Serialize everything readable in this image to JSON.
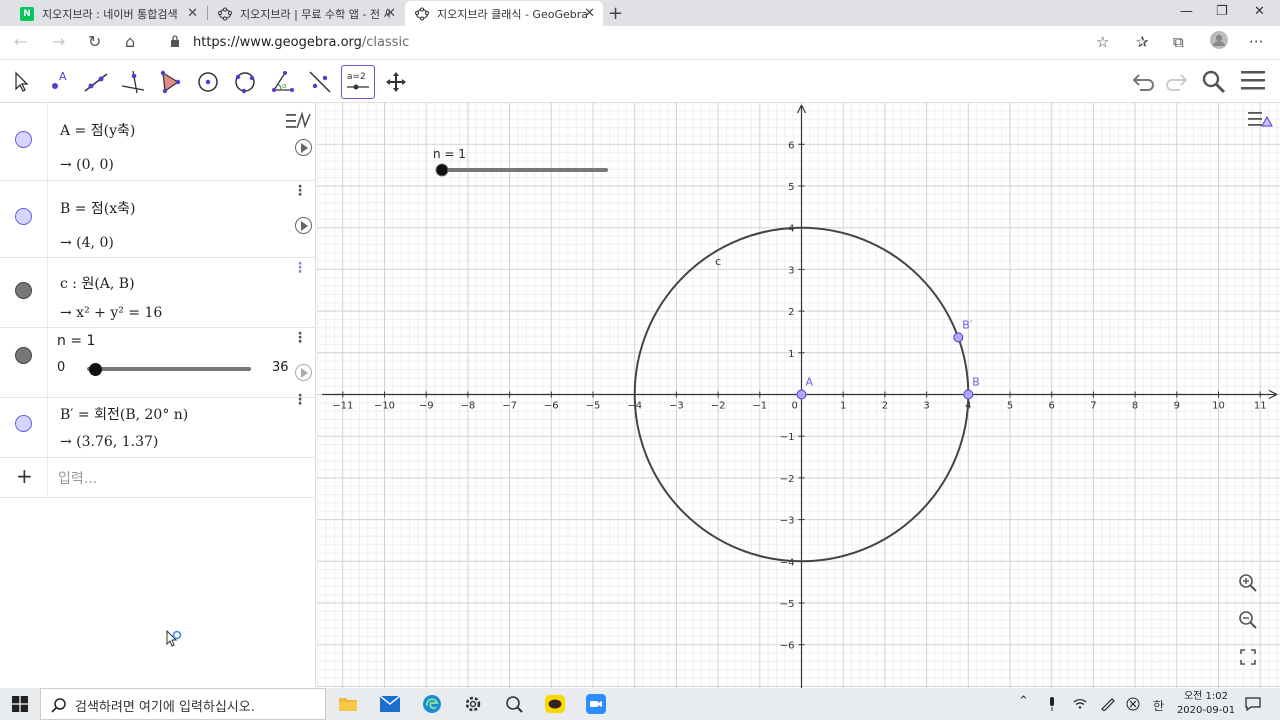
{
  "browser": {
    "tabs": [
      {
        "title": "지오지브라 : 네이버 통합검색",
        "favicon": "naver-icon",
        "active": false
      },
      {
        "title": "지오지브라 | 무료 수학 앱 - 전 세",
        "favicon": "geogebra-icon",
        "active": false
      },
      {
        "title": "지오지브라 클래식 - GeoGebra",
        "favicon": "geogebra-icon",
        "active": true
      }
    ],
    "url_host": "https://www.geogebra.org",
    "url_path": "/classic"
  },
  "toolbar": {
    "tools": [
      "move-tool",
      "point-tool",
      "line-tool",
      "perpendicular-line-tool",
      "polygon-tool",
      "circle-center-point-tool",
      "circle-three-points-tool",
      "angle-tool",
      "reflect-tool",
      "slider-tool",
      "move-graphics-tool"
    ],
    "selected_tool": "slider-tool",
    "slider_tool_label": "a=2"
  },
  "algebra": {
    "rows": [
      {
        "def": "A = 점(y축)",
        "value": "→  (0, 0)",
        "color": "#b0a8ff"
      },
      {
        "def": "B = 점(x축)",
        "value": "→  (4, 0)",
        "color": "#b0a8ff"
      },
      {
        "def": "c : 원(A, B)",
        "value": "→  x² + y² = 16",
        "color": "#616161"
      },
      {
        "def": "B′ = 회전(B, 20° n)",
        "value": "→  (3.76, 1.37)",
        "color": "#b0a8ff"
      }
    ],
    "slider": {
      "label": "n = 1",
      "min": "0",
      "max": "36",
      "value": 1
    },
    "input_placeholder": "입력..."
  },
  "graphics": {
    "slider_label": "n = 1",
    "x_ticks": [
      "−11",
      "−10",
      "−9",
      "−8",
      "−7",
      "−6",
      "−5",
      "−4",
      "−3",
      "−2",
      "−1",
      "0",
      "1",
      "2",
      "3",
      "4",
      "5",
      "6",
      "7",
      "8",
      "9",
      "10",
      "11"
    ],
    "y_ticks_pos": [
      "1",
      "2",
      "3",
      "4",
      "5",
      "6"
    ],
    "y_ticks_neg": [
      "−1",
      "−2",
      "−3",
      "−4",
      "−5",
      "−6"
    ],
    "circle_label": "c",
    "point_A": {
      "label": "A",
      "x": 0,
      "y": 0
    },
    "point_B": {
      "label": "B",
      "x": 4,
      "y": 0
    },
    "point_Bp": {
      "label": "B′",
      "x": 3.76,
      "y": 1.37
    },
    "circle_radius": 4
  },
  "taskbar": {
    "search_placeholder": "검색하려면 여기에 입력하십시오.",
    "clock_time": "오전 1:02",
    "clock_date": "2020-09-01",
    "ime": "한"
  },
  "colors": {
    "point": "#b0a8ff",
    "circle": "#444444",
    "selected_tool": "#6557d2"
  }
}
